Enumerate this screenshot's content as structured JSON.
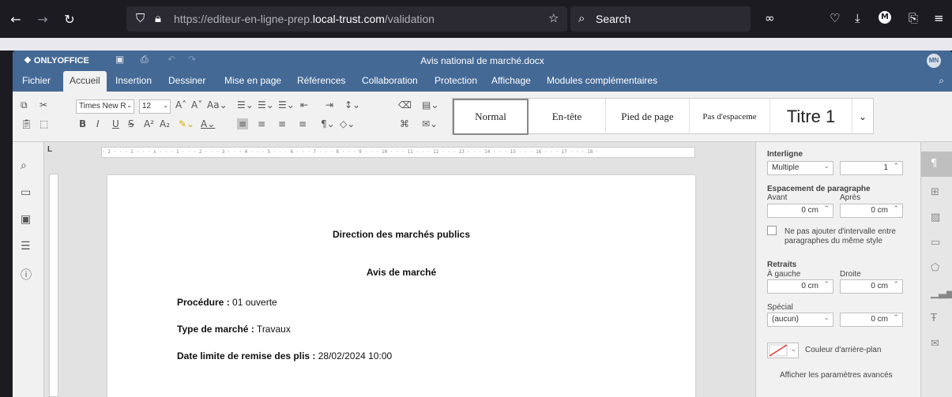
{
  "browser": {
    "url_prefix": "https://editeur-en-ligne-prep.",
    "url_domain": "local-trust.com",
    "url_suffix": "/validation",
    "search_label": "Search",
    "profile_initial": "M"
  },
  "app": {
    "brand": "ONLYOFFICE",
    "doc_title": "Avis national de marché.docx",
    "user_initials": "MN"
  },
  "tabs": [
    "Fichier",
    "Accueil",
    "Insertion",
    "Dessiner",
    "Mise en page",
    "Références",
    "Collaboration",
    "Protection",
    "Affichage",
    "Modules complémentaires"
  ],
  "toolbar": {
    "font_name": "Times New R",
    "font_size": "12",
    "styles": [
      "Normal",
      "En-tête",
      "Pied de page",
      "Pas d'espaceme",
      "Titre 1"
    ]
  },
  "ruler": "· 2 · · · 1 · · · ⅄ · · · 1 · · · 2 · · · 3 · · · 4 · · · 5 · · · 6 · · · 7 · · · 8 · · · 9 · · · 10 · · · 11 · · · 12 · · · 13 · · · 14 · · · 15 · · · 16 · · · 17 · · · 18 ·",
  "document": {
    "heading": "Direction des marchés publics",
    "subheading": "Avis de marché",
    "lines": [
      {
        "label": "Procédure :",
        "value": " 01 ouverte"
      },
      {
        "label": "Type de marché :",
        "value": " Travaux"
      },
      {
        "label": "Date limite de remise des plis :",
        "value": " 28/02/2024 10:00"
      }
    ]
  },
  "panel": {
    "interligne_label": "Interligne",
    "interligne_mode": "Multiple",
    "interligne_value": "1",
    "espacement_label": "Espacement de paragraphe",
    "avant_label": "Avant",
    "apres_label": "Après",
    "avant_value": "0 cm",
    "apres_value": "0 cm",
    "checkbox_label_1": "Ne pas ajouter d'intervalle entre",
    "checkbox_label_2": "paragraphes du même style",
    "retraits_label": "Retraits",
    "gauche_label": "À gauche",
    "droite_label": "Droite",
    "gauche_value": "0 cm",
    "droite_value": "0 cm",
    "special_label": "Spécial",
    "special_mode": "(aucun)",
    "special_value": "0 cm",
    "bg_color_label": "Couleur d'arrière-plan",
    "advanced_link": "Afficher les paramètres avancés"
  }
}
